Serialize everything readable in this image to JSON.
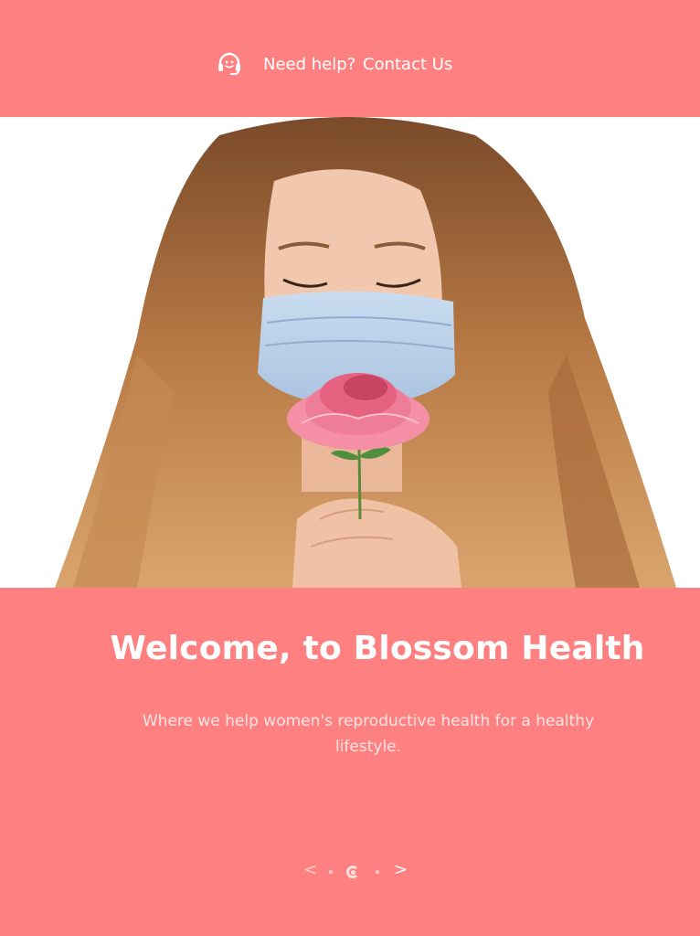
{
  "topbar": {
    "help_icon": "headset-icon",
    "help_label": "Need help?",
    "contact_label": "Contact Us"
  },
  "hero": {
    "image": "woman-mask-flower-photo"
  },
  "welcome": {
    "title": "Welcome, to Blossom Health",
    "subtitle": "Where we help women's reproductive health for a healthy lifestyle."
  },
  "slider": {
    "prev_label": "<",
    "next_label": ">",
    "slide_count": 3,
    "active_index": 2
  },
  "colors": {
    "brand": "#ff8080",
    "text": "#ffffff"
  }
}
